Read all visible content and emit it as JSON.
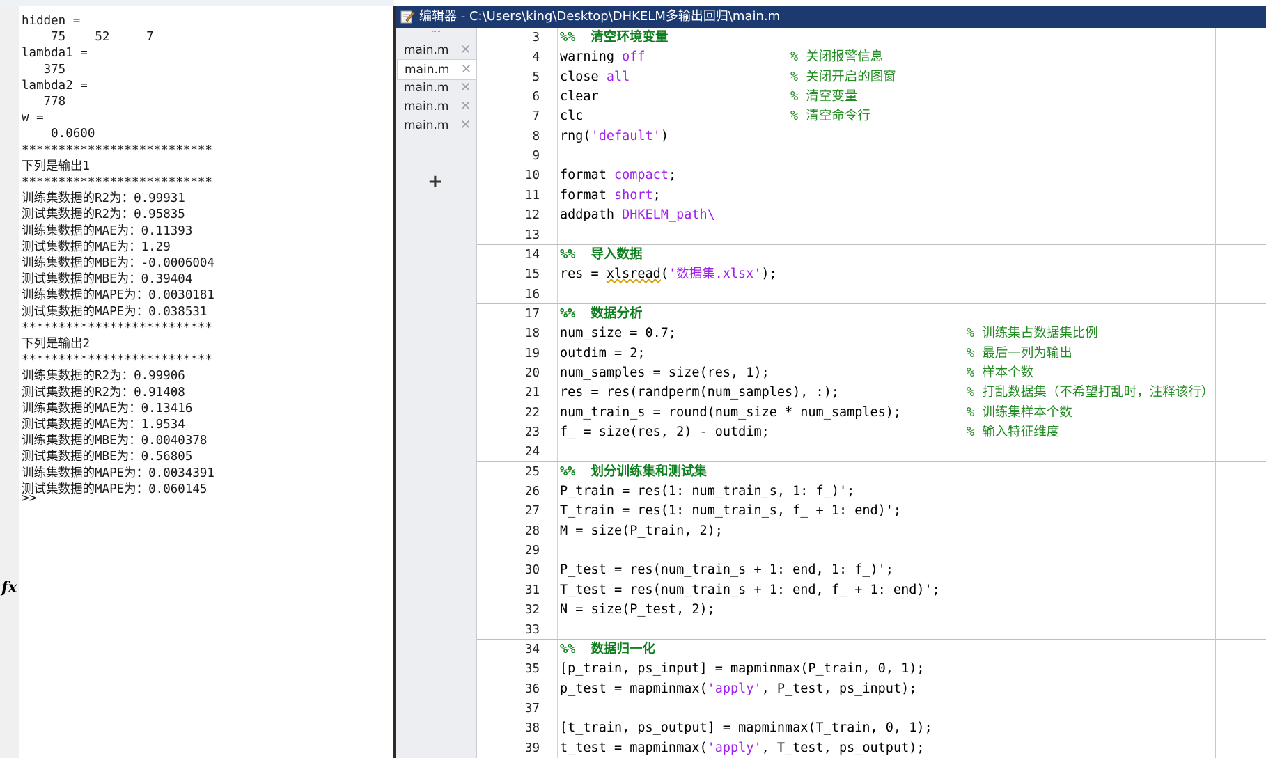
{
  "console": {
    "lines": [
      "hidden =",
      "    75    52     7",
      "lambda1 =",
      "   375",
      "lambda2 =",
      "   778",
      "w =",
      "    0.0600",
      "**************************",
      "下列是输出1",
      "**************************",
      "训练集数据的R2为：0.99931",
      "测试集数据的R2为：0.95835",
      "训练集数据的MAE为：0.11393",
      "测试集数据的MAE为：1.29",
      "训练集数据的MBE为：-0.0006004",
      "测试集数据的MBE为：0.39404",
      "训练集数据的MAPE为：0.0030181",
      "测试集数据的MAPE为：0.038531",
      "**************************",
      "下列是输出2",
      "**************************",
      "训练集数据的R2为：0.99906",
      "测试集数据的R2为：0.91408",
      "训练集数据的MAE为：0.13416",
      "测试集数据的MAE为：1.9534",
      "训练集数据的MBE为：0.0040378",
      "测试集数据的MBE为：0.56805",
      "训练集数据的MAPE为：0.0034391",
      "测试集数据的MAPE为：0.060145"
    ],
    "fx": "fx",
    "prompt": ">>"
  },
  "editor": {
    "title": "编辑器 - C:\\Users\\king\\Desktop\\DHKELM多输出回归\\main.m",
    "tabs": [
      {
        "label": "main.m",
        "close": "✕",
        "active": false
      },
      {
        "label": "main.m",
        "close": "✕",
        "active": true
      },
      {
        "label": "main.m",
        "close": "✕",
        "active": false
      },
      {
        "label": "main.m",
        "close": "✕",
        "active": false
      },
      {
        "label": "main.m",
        "close": "✕",
        "active": false
      }
    ],
    "add_tab": "+",
    "lines": [
      {
        "n": "3",
        "code": "%%  清空环境变量",
        "type": "section"
      },
      {
        "n": "4",
        "parts": [
          [
            "warning ",
            ""
          ],
          [
            "off",
            "kw"
          ]
        ],
        "comment": "% 关闭报警信息",
        "ccol": 1
      },
      {
        "n": "5",
        "parts": [
          [
            "close ",
            ""
          ],
          [
            "all",
            "kw"
          ]
        ],
        "comment": "% 关闭开启的图窗",
        "ccol": 1
      },
      {
        "n": "6",
        "parts": [
          [
            "clear",
            ""
          ]
        ],
        "comment": "% 清空变量",
        "ccol": 1
      },
      {
        "n": "7",
        "parts": [
          [
            "clc",
            ""
          ]
        ],
        "comment": "% 清空命令行",
        "ccol": 1
      },
      {
        "n": "8",
        "parts": [
          [
            "rng(",
            ""
          ],
          [
            "'default'",
            "str"
          ],
          [
            ")",
            ""
          ]
        ]
      },
      {
        "n": "9",
        "parts": []
      },
      {
        "n": "10",
        "parts": [
          [
            "format ",
            ""
          ],
          [
            "compact",
            "kw"
          ],
          [
            ";",
            ""
          ]
        ]
      },
      {
        "n": "11",
        "parts": [
          [
            "format ",
            ""
          ],
          [
            "short",
            "kw"
          ],
          [
            ";",
            ""
          ]
        ]
      },
      {
        "n": "12",
        "parts": [
          [
            "addpath ",
            ""
          ],
          [
            "DHKELM_path\\",
            "kw"
          ]
        ]
      },
      {
        "n": "13",
        "parts": []
      },
      {
        "n": "14",
        "code": "%%  导入数据",
        "type": "section"
      },
      {
        "n": "15",
        "parts": [
          [
            "res = ",
            ""
          ],
          [
            "xlsread",
            "squig"
          ],
          [
            "(",
            ""
          ],
          [
            "'数据集.xlsx'",
            "str"
          ],
          [
            ");",
            ""
          ]
        ]
      },
      {
        "n": "16",
        "parts": []
      },
      {
        "n": "17",
        "code": "%%  数据分析",
        "type": "section"
      },
      {
        "n": "18",
        "parts": [
          [
            "num_size = 0.7;",
            ""
          ]
        ],
        "comment": "% 训练集占数据集比例",
        "ccol": 2
      },
      {
        "n": "19",
        "parts": [
          [
            "outdim = 2;",
            ""
          ]
        ],
        "comment": "% 最后一列为输出",
        "ccol": 2
      },
      {
        "n": "20",
        "parts": [
          [
            "num_samples = size(res, 1);",
            ""
          ]
        ],
        "comment": "% 样本个数",
        "ccol": 2
      },
      {
        "n": "21",
        "parts": [
          [
            "res = res(randperm(num_samples), :);",
            ""
          ]
        ],
        "comment": "% 打乱数据集（不希望打乱时，注释该行）",
        "ccol": 2
      },
      {
        "n": "22",
        "parts": [
          [
            "num_train_s = round(num_size * num_samples);",
            ""
          ]
        ],
        "comment": "% 训练集样本个数",
        "ccol": 2
      },
      {
        "n": "23",
        "parts": [
          [
            "f_ = size(res, 2) - outdim;",
            ""
          ]
        ],
        "comment": "% 输入特征维度",
        "ccol": 2
      },
      {
        "n": "24",
        "parts": []
      },
      {
        "n": "25",
        "code": "%%  划分训练集和测试集",
        "type": "section"
      },
      {
        "n": "26",
        "parts": [
          [
            "P_train = res(1: num_train_s, 1: f_)';",
            ""
          ]
        ]
      },
      {
        "n": "27",
        "parts": [
          [
            "T_train = res(1: num_train_s, f_ + 1: end)';",
            ""
          ]
        ]
      },
      {
        "n": "28",
        "parts": [
          [
            "M = size(P_train, 2);",
            ""
          ]
        ]
      },
      {
        "n": "29",
        "parts": []
      },
      {
        "n": "30",
        "parts": [
          [
            "P_test = res(num_train_s + 1: end, 1: f_)';",
            ""
          ]
        ]
      },
      {
        "n": "31",
        "parts": [
          [
            "T_test = res(num_train_s + 1: end, f_ + 1: end)';",
            ""
          ]
        ]
      },
      {
        "n": "32",
        "parts": [
          [
            "N = size(P_test, 2);",
            ""
          ]
        ]
      },
      {
        "n": "33",
        "parts": []
      },
      {
        "n": "34",
        "code": "%%  数据归一化",
        "type": "section"
      },
      {
        "n": "35",
        "parts": [
          [
            "[p_train, ps_input] = mapminmax(P_train, 0, 1);",
            ""
          ]
        ]
      },
      {
        "n": "36",
        "parts": [
          [
            "p_test = mapminmax(",
            ""
          ],
          [
            "'apply'",
            "str"
          ],
          [
            ", P_test, ps_input);",
            ""
          ]
        ]
      },
      {
        "n": "37",
        "parts": []
      },
      {
        "n": "38",
        "parts": [
          [
            "[t_train, ps_output] = mapminmax(T_train, 0, 1);",
            ""
          ]
        ]
      },
      {
        "n": "39",
        "parts": [
          [
            "t_test = mapminmax(",
            ""
          ],
          [
            "'apply'",
            "str"
          ],
          [
            ", T_test, ps_output);",
            ""
          ]
        ]
      }
    ]
  }
}
